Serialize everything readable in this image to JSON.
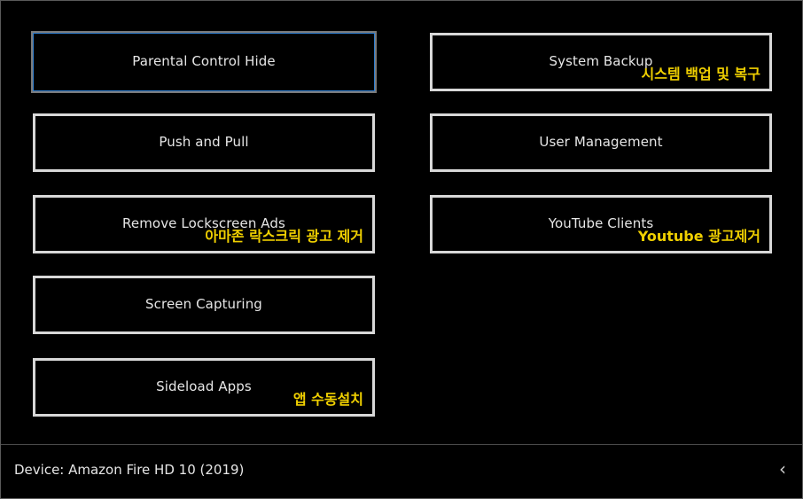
{
  "tiles": {
    "parental_control_hide": {
      "label": "Parental Control Hide"
    },
    "system_backup": {
      "label": "System Backup",
      "overlay": "시스템 백업 및 복구"
    },
    "push_and_pull": {
      "label": "Push and Pull"
    },
    "user_management": {
      "label": "User Management"
    },
    "remove_lockscreen_ads": {
      "label": "Remove Lockscreen Ads",
      "overlay": "아마존 락스크릭 광고 제거"
    },
    "youtube_clients": {
      "label": "YouTube Clients",
      "overlay": "Youtube 광고제거"
    },
    "screen_capturing": {
      "label": "Screen Capturing"
    },
    "sideload_apps": {
      "label": "Sideload Apps",
      "overlay": "앱 수동설치"
    }
  },
  "status": {
    "device_text": "Device: Amazon Fire HD 10 (2019)",
    "collapse_glyph": "‹"
  },
  "colors": {
    "background": "#000000",
    "tile_border": "#d8d8d8",
    "selected_border": "#2f7fd2",
    "overlay_text": "#f0d000",
    "label_text": "#e6e6e6"
  }
}
